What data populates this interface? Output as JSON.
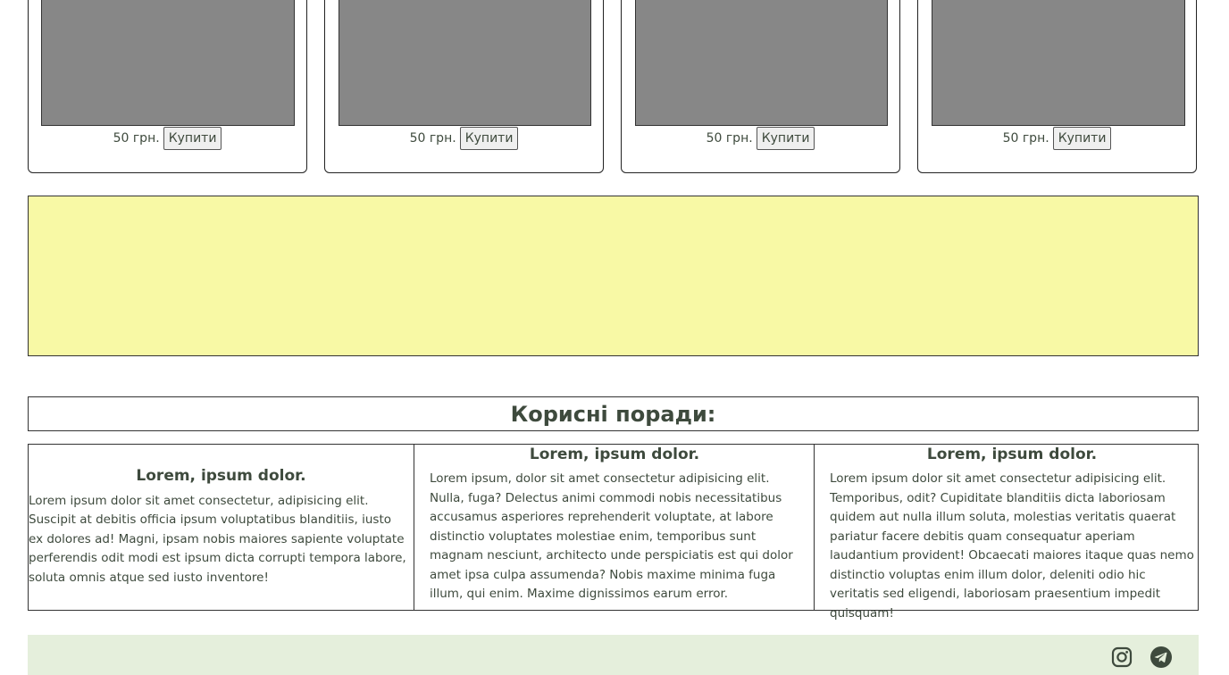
{
  "products": [
    {
      "price": "50 грн.",
      "buy_label": "Купити"
    },
    {
      "price": "50 грн.",
      "buy_label": "Купити"
    },
    {
      "price": "50 грн.",
      "buy_label": "Купити"
    },
    {
      "price": "50 грн.",
      "buy_label": "Купити"
    }
  ],
  "banner": {
    "color": "#f8f9a5"
  },
  "tips": {
    "title": "Корисні поради:",
    "items": [
      {
        "heading": "Lorem, ipsum dolor.",
        "text": "Lorem ipsum dolor sit amet consectetur, adipisicing elit. Suscipit at debitis officia ipsum voluptatibus blanditiis, iusto ex dolores ad! Magni, ipsam nobis maiores sapiente voluptate perferendis odit modi est ipsum dicta corrupti tempora labore, soluta omnis atque sed iusto inventore!"
      },
      {
        "heading": "Lorem, ipsum dolor.",
        "text": "Lorem ipsum, dolor sit amet consectetur adipisicing elit. Nulla, fuga? Delectus animi commodi nobis necessitatibus accusamus asperiores reprehenderit voluptate, at labore distinctio voluptates molestiae enim, temporibus sunt magnam nesciunt, architecto unde perspiciatis est qui dolor amet ipsa culpa assumenda? Nobis maxime minima fuga illum, qui enim. Maxime dignissimos earum error."
      },
      {
        "heading": "Lorem, ipsum dolor.",
        "text": "Lorem ipsum dolor sit amet consectetur adipisicing elit. Temporibus, odit? Cupiditate blanditiis dicta laboriosam quidem aut nulla illum soluta, molestias veritatis quaerat pariatur facere debitis quam consequatur aperiam laudantium provident! Obcaecati maiores itaque quas nemo distinctio voluptas enim illum dolor, deleniti odio hic veritatis sed eligendi, laboriosam praesentium impedit quisquam!"
      }
    ]
  },
  "footer": {
    "icons": [
      "instagram-icon",
      "telegram-icon"
    ],
    "background": "#e5efdc"
  }
}
